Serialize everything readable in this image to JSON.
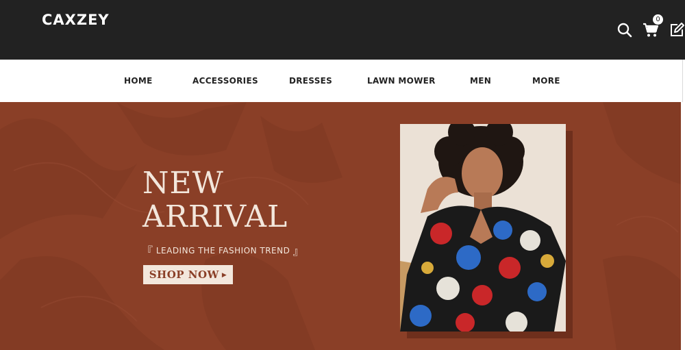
{
  "header": {
    "logo": "CAXZEY",
    "cart_count": "0",
    "icons": [
      "search-icon",
      "cart-icon",
      "edit-icon"
    ]
  },
  "nav": {
    "items": [
      {
        "label": "HOME"
      },
      {
        "label": "ACCESSORIES"
      },
      {
        "label": "DRESSES"
      },
      {
        "label": "LAWN MOWER"
      },
      {
        "label": "MEN"
      },
      {
        "label": "MORE"
      }
    ]
  },
  "hero": {
    "headline_line1": "NEW",
    "headline_line2": "ARRIVAL",
    "bracket_open": "『",
    "tagline": "LEADING THE FASHION TREND",
    "bracket_close": "』",
    "button_label": "SHOP NOW",
    "button_arrow": "▶"
  },
  "colors": {
    "topbar": "#222222",
    "hero_background": "#8a3f27",
    "hero_text": "#f3e7dc"
  }
}
